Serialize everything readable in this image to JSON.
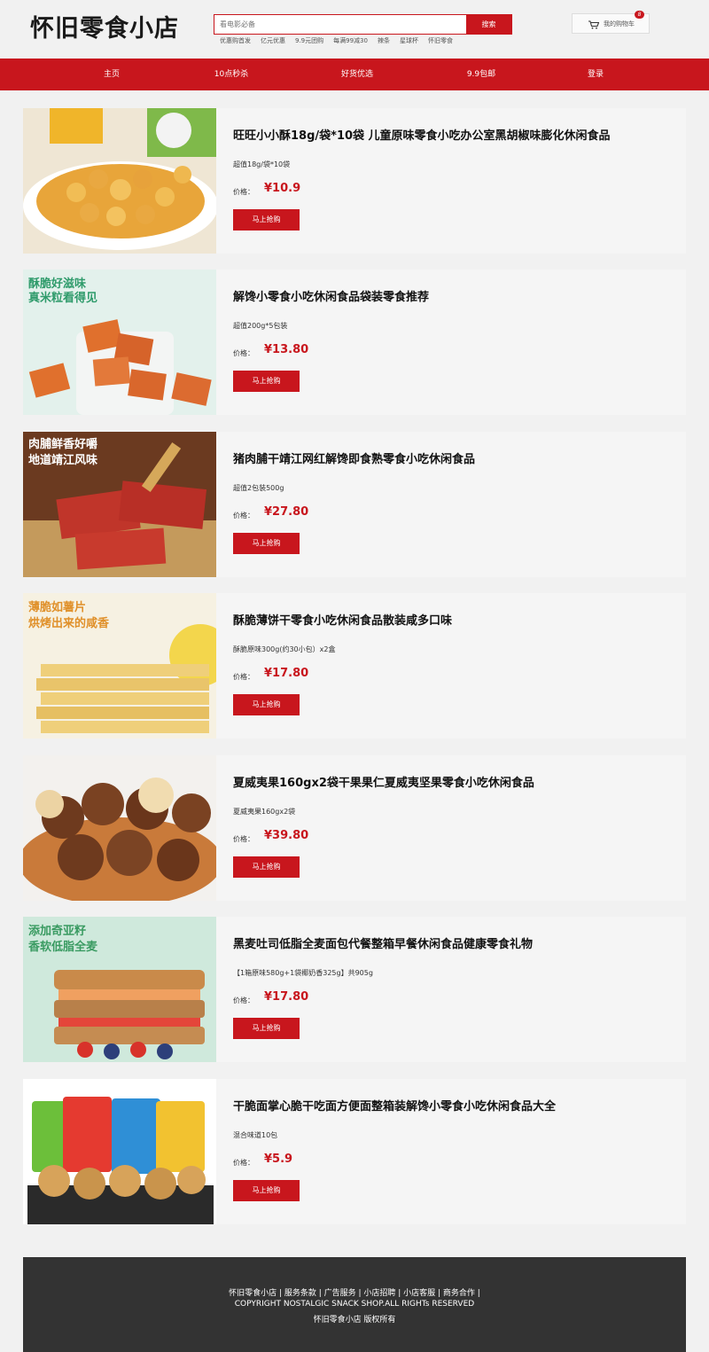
{
  "header": {
    "logo": "怀旧零食小店",
    "search": {
      "placeholder": "看电影必备",
      "button_label": "搜索"
    },
    "hot_links": [
      "优惠购首发",
      "亿元优惠",
      "9.9元团购",
      "每满99减30",
      "辣条",
      "星球杯",
      "怀旧零食"
    ],
    "cart": {
      "label": "我的购物车",
      "count": "8"
    }
  },
  "nav": {
    "items": [
      "主页",
      "10点秒杀",
      "好货优选",
      "9.9包邮",
      "登录"
    ]
  },
  "price_label": "价格：",
  "buy_label": "马上抢购",
  "products": [
    {
      "title": "旺旺小小酥18g/袋*10袋 儿童原味零食小吃办公室黑胡椒味膨化休闲食品",
      "spec": "超值18g/袋*10袋",
      "price": "¥10.9",
      "image_text": [
        "",
        ""
      ]
    },
    {
      "title": "解馋小零食小吃休闲食品袋装零食推荐",
      "spec": "超值200g*5包装",
      "price": "¥13.80",
      "image_text": [
        "酥脆好滋味",
        "真米粒看得见"
      ]
    },
    {
      "title": "猪肉脯干靖江网红解馋即食熟零食小吃休闲食品",
      "spec": "超值2包装500g",
      "price": "¥27.80",
      "image_text": [
        "肉脯鲜香好嚼",
        "地道靖江风味"
      ]
    },
    {
      "title": "酥脆薄饼干零食小吃休闲食品散装咸多口味",
      "spec": "酥脆原味300g(约30小包）x2盒",
      "price": "¥17.80",
      "image_text": [
        "薄脆如薯片",
        "烘烤出来的咸香"
      ]
    },
    {
      "title": "夏威夷果160gx2袋干果果仁夏威夷坚果零食小吃休闲食品",
      "spec": "夏威夷果160gx2袋",
      "price": "¥39.80",
      "image_text": [
        "",
        ""
      ]
    },
    {
      "title": "黑麦吐司低脂全麦面包代餐整箱早餐休闲食品健康零食礼物",
      "spec": "【1箱原味580g+1袋椰奶香325g】共905g",
      "price": "¥17.80",
      "image_text": [
        "添加奇亚籽",
        "香软低脂全麦"
      ]
    },
    {
      "title": "干脆面掌心脆干吃面方便面整箱装解馋小零食小吃休闲食品大全",
      "spec": "混合味道10包",
      "price": "¥5.9",
      "image_text": [
        "",
        ""
      ]
    }
  ],
  "footer": {
    "links": "怀旧零食小店 | 服务条款 | 广告服务 | 小店招聘 | 小店客服 | 商务合作 |",
    "copyright": "COPYRIGHT NOSTALGIC SNACK SHOP.ALL RIGHTs RESERVED",
    "rights": "怀旧零食小店 版权所有"
  }
}
